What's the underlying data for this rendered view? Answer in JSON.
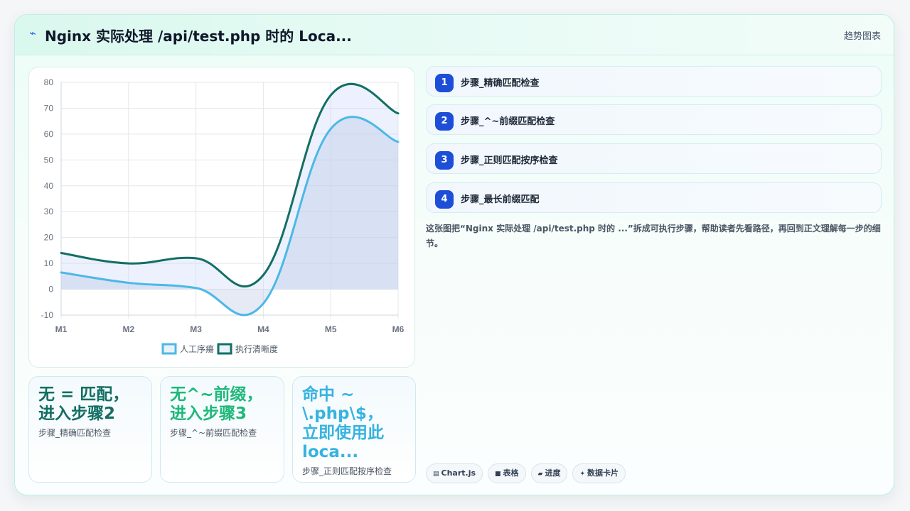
{
  "header": {
    "icon": "lightning-icon",
    "title": "Nginx 实际处理 /api/test.php 时的 Loca...",
    "tag": "趋势图表"
  },
  "chart_data": {
    "type": "line",
    "categories": [
      "M1",
      "M2",
      "M3",
      "M4",
      "M5",
      "M6"
    ],
    "series": [
      {
        "name": "人工序瘍",
        "values": [
          6.5,
          2.5,
          0.5,
          -5.5,
          62,
          57
        ],
        "color": "#4cb8e6"
      },
      {
        "name": "执行清晰度",
        "values": [
          14,
          10,
          12,
          5.5,
          75,
          68
        ],
        "color": "#136f63"
      }
    ],
    "ylim": [
      -10,
      80
    ],
    "yticks": [
      -10,
      0,
      10,
      20,
      30,
      40,
      50,
      60,
      70,
      80
    ],
    "grid": true,
    "legend_position": "bottom",
    "area_fill": true
  },
  "stats": [
    {
      "value_lines": [
        "无 = 匹配，",
        "进入步骤2"
      ],
      "label": "步骤_精确匹配检查",
      "color": "#136f63"
    },
    {
      "value_lines": [
        "无^~前缀，",
        "进入步骤3"
      ],
      "label": "步骤_^~前缀匹配检查",
      "color": "#1fb87a"
    },
    {
      "value_lines": [
        "命中 ~",
        "\\.php\\$，",
        "立即使用此",
        "loca..."
      ],
      "label": "步骤_正则匹配按序检查",
      "color": "#36b3e0"
    }
  ],
  "steps": [
    {
      "num": "1",
      "label": "步骤_精确匹配检查"
    },
    {
      "num": "2",
      "label": "步骤_^~前缀匹配检查"
    },
    {
      "num": "3",
      "label": "步骤_正则匹配按序检查"
    },
    {
      "num": "4",
      "label": "步骤_最长前缀匹配"
    }
  ],
  "description": "这张图把“Nginx 实际处理 /api/test.php 时的 ...”拆成可执行步骤，帮助读者先看路径，再回到正文理解每一步的细节。",
  "chips": [
    {
      "icon": "chart-icon",
      "glyph": "▤",
      "label": "Chart.js"
    },
    {
      "icon": "table-icon",
      "glyph": "■",
      "label": "表格"
    },
    {
      "icon": "progress-icon",
      "glyph": "▰",
      "label": "进度"
    },
    {
      "icon": "sparkle-icon",
      "glyph": "✦",
      "label": "数据卡片"
    }
  ]
}
